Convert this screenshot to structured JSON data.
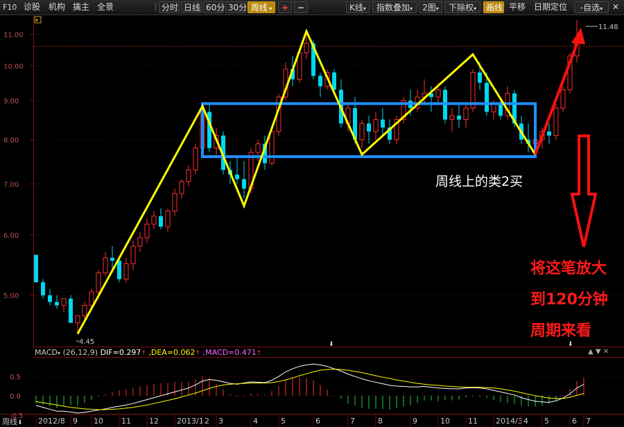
{
  "toolbar": {
    "f10": "F10",
    "diagnose": "诊股",
    "institution": "机构",
    "chief": "擒主",
    "overview": "全景",
    "period_buttons": [
      "分时",
      "日线",
      "60分",
      "30分",
      "周线"
    ],
    "active_period": "周线",
    "plus": "+",
    "minus": "−",
    "kline": "K线",
    "index_overlay": "指数叠加",
    "two_charts": "2图",
    "adjust": "下除权",
    "draw_line": "画线",
    "pan": "平移",
    "date_locate": "日期定位",
    "self_select": "-自选",
    "close": "✕"
  },
  "annotations": {
    "weekly_buy": "周线上的类2买",
    "zoom_line1": "将这笔放大",
    "zoom_line2": "到120分钟",
    "zoom_line3": "周期来看"
  },
  "price_labels": {
    "high": "11.48",
    "low": "4.45"
  },
  "macd_header": {
    "name": "MACD",
    "params": "(26,12,9)",
    "dif": "DIF=0.297",
    "dea": ",DEA=0.062",
    "macd": ",MACD=0.471"
  },
  "footer": {
    "period": "周线"
  },
  "colors": {
    "up": "#ff3030",
    "down": "#00d8f0",
    "stroke": "#ffff00",
    "box": "#1e90ff",
    "arrow": "#ff1010",
    "dif": "#ffffff",
    "dea": "#ffff00"
  },
  "chart_data": {
    "type": "candlestick",
    "period": "weekly",
    "ylim": [
      4.3,
      11.6
    ],
    "y_scale": "log",
    "yticks": [
      "11.00",
      "10.00",
      "9.00",
      "8.00",
      "7.00",
      "6.00",
      "5.00"
    ],
    "ytick_values": [
      11,
      10,
      9,
      8,
      7,
      6,
      5
    ],
    "xticks": [
      "2012/8",
      "9",
      "10",
      "11",
      "12",
      "2013/1",
      "2",
      "3",
      "4",
      "5",
      "6",
      "7",
      "8",
      "9",
      "10",
      "11",
      "2014/3",
      "4",
      "5",
      "6",
      "7"
    ],
    "candles": [
      [
        5.65,
        5.65,
        5.2,
        5.2
      ],
      [
        5.2,
        5.25,
        4.95,
        5.0
      ],
      [
        5.0,
        5.1,
        4.85,
        4.9
      ],
      [
        4.9,
        5.0,
        4.8,
        4.85
      ],
      [
        4.85,
        4.95,
        4.75,
        4.95
      ],
      [
        4.95,
        5.0,
        4.6,
        4.6
      ],
      [
        4.6,
        4.7,
        4.45,
        4.7
      ],
      [
        4.7,
        4.9,
        4.65,
        4.85
      ],
      [
        4.85,
        5.1,
        4.8,
        5.05
      ],
      [
        5.05,
        5.4,
        5.0,
        5.35
      ],
      [
        5.35,
        5.7,
        5.3,
        5.6
      ],
      [
        5.6,
        5.8,
        5.4,
        5.55
      ],
      [
        5.55,
        5.6,
        5.2,
        5.25
      ],
      [
        5.25,
        5.6,
        5.2,
        5.5
      ],
      [
        5.5,
        5.9,
        5.4,
        5.8
      ],
      [
        5.8,
        6.05,
        5.7,
        5.95
      ],
      [
        5.95,
        6.3,
        5.85,
        6.2
      ],
      [
        6.2,
        6.45,
        6.1,
        6.35
      ],
      [
        6.35,
        6.5,
        6.1,
        6.15
      ],
      [
        6.15,
        6.5,
        6.05,
        6.45
      ],
      [
        6.45,
        6.9,
        6.35,
        6.8
      ],
      [
        6.8,
        7.1,
        6.7,
        7.05
      ],
      [
        7.05,
        7.4,
        6.95,
        7.3
      ],
      [
        7.3,
        7.9,
        7.2,
        7.8
      ],
      [
        7.8,
        8.8,
        7.7,
        8.7
      ],
      [
        8.7,
        8.9,
        7.7,
        7.8
      ],
      [
        7.8,
        8.3,
        7.6,
        8.1
      ],
      [
        8.1,
        8.2,
        7.2,
        7.3
      ],
      [
        7.3,
        7.5,
        7.0,
        7.2
      ],
      [
        7.2,
        7.6,
        7.0,
        7.1
      ],
      [
        7.1,
        7.5,
        6.7,
        6.9
      ],
      [
        6.9,
        7.8,
        6.8,
        7.7
      ],
      [
        7.7,
        8.0,
        7.5,
        7.9
      ],
      [
        7.9,
        8.1,
        7.3,
        7.45
      ],
      [
        7.45,
        8.3,
        7.4,
        8.2
      ],
      [
        8.2,
        9.2,
        8.1,
        9.1
      ],
      [
        9.1,
        10.1,
        9.0,
        9.9
      ],
      [
        9.9,
        10.3,
        9.4,
        9.6
      ],
      [
        9.6,
        10.5,
        9.5,
        10.4
      ],
      [
        10.4,
        11.0,
        10.2,
        10.7
      ],
      [
        10.7,
        10.8,
        9.6,
        9.7
      ],
      [
        9.7,
        9.8,
        9.1,
        9.4
      ],
      [
        9.4,
        9.9,
        9.3,
        9.8
      ],
      [
        9.8,
        9.9,
        9.2,
        9.3
      ],
      [
        9.3,
        9.6,
        8.3,
        8.4
      ],
      [
        8.4,
        8.9,
        8.2,
        8.8
      ],
      [
        8.8,
        9.1,
        7.9,
        8.0
      ],
      [
        8.0,
        8.5,
        7.8,
        8.4
      ],
      [
        8.4,
        8.6,
        7.9,
        8.2
      ],
      [
        8.2,
        8.7,
        8.0,
        8.5
      ],
      [
        8.5,
        8.8,
        8.1,
        8.3
      ],
      [
        8.3,
        8.5,
        7.9,
        8.0
      ],
      [
        8.0,
        8.6,
        7.9,
        8.5
      ],
      [
        8.5,
        9.1,
        8.4,
        9.0
      ],
      [
        9.0,
        9.3,
        8.6,
        8.8
      ],
      [
        8.8,
        9.3,
        8.7,
        9.1
      ],
      [
        9.1,
        9.6,
        8.9,
        9.2
      ],
      [
        9.2,
        9.4,
        8.7,
        9.1
      ],
      [
        9.1,
        9.5,
        8.9,
        9.3
      ],
      [
        9.3,
        9.4,
        8.4,
        8.5
      ],
      [
        8.5,
        8.8,
        8.2,
        8.6
      ],
      [
        8.6,
        8.9,
        8.3,
        8.5
      ],
      [
        8.5,
        8.9,
        8.3,
        8.8
      ],
      [
        8.8,
        9.9,
        8.7,
        9.8
      ],
      [
        9.8,
        10.1,
        9.3,
        9.5
      ],
      [
        9.5,
        9.8,
        8.6,
        8.7
      ],
      [
        8.7,
        9.0,
        8.5,
        8.9
      ],
      [
        8.9,
        9.0,
        8.5,
        8.6
      ],
      [
        8.6,
        9.4,
        8.5,
        9.2
      ],
      [
        9.2,
        9.3,
        8.3,
        8.4
      ],
      [
        8.4,
        8.6,
        7.9,
        8.0
      ],
      [
        8.0,
        8.4,
        7.7,
        7.9
      ],
      [
        7.9,
        8.1,
        7.6,
        8.0
      ],
      [
        8.0,
        8.3,
        7.8,
        8.2
      ],
      [
        8.2,
        8.4,
        7.9,
        8.1
      ],
      [
        8.1,
        8.9,
        8.0,
        8.8
      ],
      [
        8.8,
        9.4,
        8.7,
        9.3
      ],
      [
        9.3,
        10.4,
        9.2,
        10.3
      ],
      [
        10.3,
        11.48,
        10.1,
        10.8
      ]
    ],
    "stroke_points": [
      [
        6,
        4.45
      ],
      [
        24,
        8.85
      ],
      [
        30,
        6.55
      ],
      [
        39,
        11.1
      ],
      [
        47,
        7.65
      ],
      [
        63,
        10.35
      ],
      [
        72,
        7.65
      ]
    ],
    "box": {
      "x_start_index": 24,
      "x_end_index": 72,
      "top": 8.92,
      "bottom": 7.6
    },
    "macd": {
      "ylim": [
        -0.45,
        0.95
      ],
      "yticks": [
        "0.5",
        "0.0",
        "-0.5"
      ],
      "ytick_values": [
        0.5,
        0.0,
        -0.5
      ],
      "dif": [
        -0.25,
        -0.3,
        -0.35,
        -0.4,
        -0.4,
        -0.42,
        -0.45,
        -0.43,
        -0.4,
        -0.37,
        -0.34,
        -0.3,
        -0.27,
        -0.24,
        -0.2,
        -0.15,
        -0.1,
        -0.05,
        0.0,
        0.05,
        0.1,
        0.15,
        0.2,
        0.28,
        0.38,
        0.42,
        0.4,
        0.36,
        0.32,
        0.3,
        0.33,
        0.36,
        0.35,
        0.34,
        0.4,
        0.5,
        0.62,
        0.7,
        0.76,
        0.8,
        0.82,
        0.8,
        0.76,
        0.7,
        0.64,
        0.56,
        0.5,
        0.44,
        0.39,
        0.35,
        0.31,
        0.27,
        0.25,
        0.24,
        0.23,
        0.23,
        0.24,
        0.22,
        0.2,
        0.19,
        0.18,
        0.18,
        0.2,
        0.21,
        0.2,
        0.18,
        0.14,
        0.1,
        0.06,
        0.02,
        -0.05,
        -0.1,
        -0.14,
        -0.16,
        -0.17,
        -0.13,
        -0.06,
        0.05,
        0.2,
        0.297
      ],
      "dea": [
        -0.15,
        -0.18,
        -0.21,
        -0.24,
        -0.27,
        -0.3,
        -0.32,
        -0.34,
        -0.35,
        -0.36,
        -0.36,
        -0.35,
        -0.34,
        -0.32,
        -0.3,
        -0.27,
        -0.24,
        -0.2,
        -0.16,
        -0.12,
        -0.08,
        -0.03,
        0.02,
        0.07,
        0.13,
        0.19,
        0.24,
        0.28,
        0.3,
        0.31,
        0.32,
        0.33,
        0.33,
        0.33,
        0.34,
        0.37,
        0.41,
        0.46,
        0.52,
        0.57,
        0.62,
        0.66,
        0.68,
        0.69,
        0.68,
        0.66,
        0.63,
        0.6,
        0.56,
        0.52,
        0.48,
        0.45,
        0.41,
        0.38,
        0.35,
        0.32,
        0.3,
        0.28,
        0.27,
        0.25,
        0.24,
        0.23,
        0.22,
        0.22,
        0.22,
        0.21,
        0.2,
        0.18,
        0.15,
        0.12,
        0.08,
        0.04,
        0.0,
        -0.03,
        -0.06,
        -0.07,
        -0.07,
        -0.04,
        0.01,
        0.062
      ]
    }
  }
}
